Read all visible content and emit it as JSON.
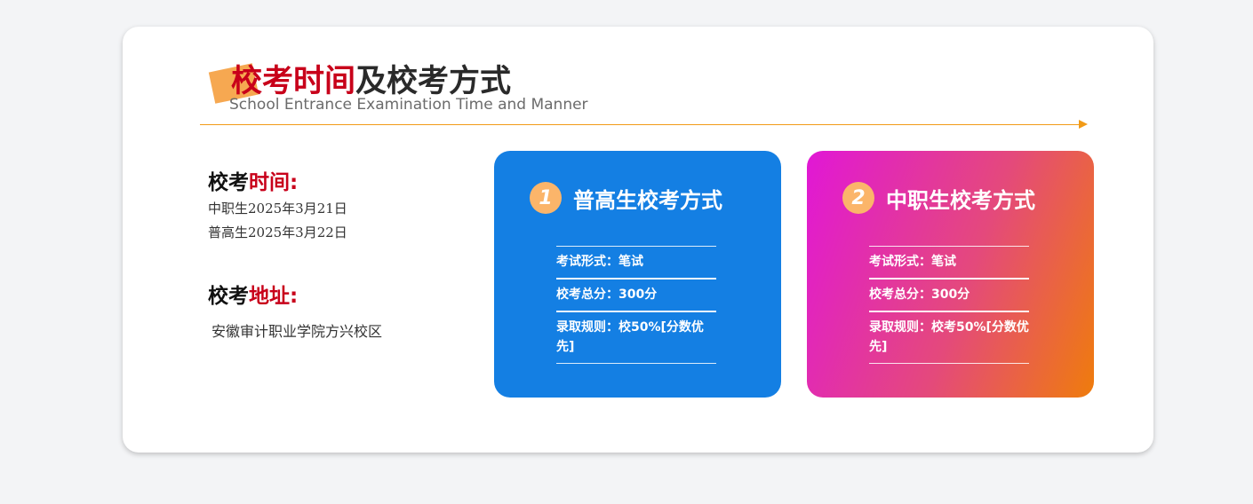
{
  "title": {
    "highlight": "校考时间",
    "rest": "及校考方式",
    "subtitle": "School Entrance Examination Time and Manner"
  },
  "time_section": {
    "heading_plain": "校考",
    "heading_highlight": "时间:",
    "lines": [
      "中职生2025年3月21日",
      "普高生2025年3月22日"
    ]
  },
  "address_section": {
    "heading_plain": "校考",
    "heading_highlight": "地址:",
    "address": "安徽审计职业学院方兴校区"
  },
  "panels": [
    {
      "number": "1",
      "title": "普高生校考方式",
      "items": [
        "考试形式：笔试",
        "校考总分：300分",
        "录取规则：校50%[分数优先]"
      ]
    },
    {
      "number": "2",
      "title": "中职生校考方式",
      "items": [
        "考试形式：笔试",
        "校考总分：300分",
        "录取规则：校考50%[分数优先]"
      ]
    }
  ],
  "colors": {
    "accent_red": "#c8001a",
    "accent_orange": "#f29b17",
    "panel_blue": "#147fe3",
    "panel_gradient_start": "#e117d6",
    "panel_gradient_end": "#ef7c0c"
  }
}
